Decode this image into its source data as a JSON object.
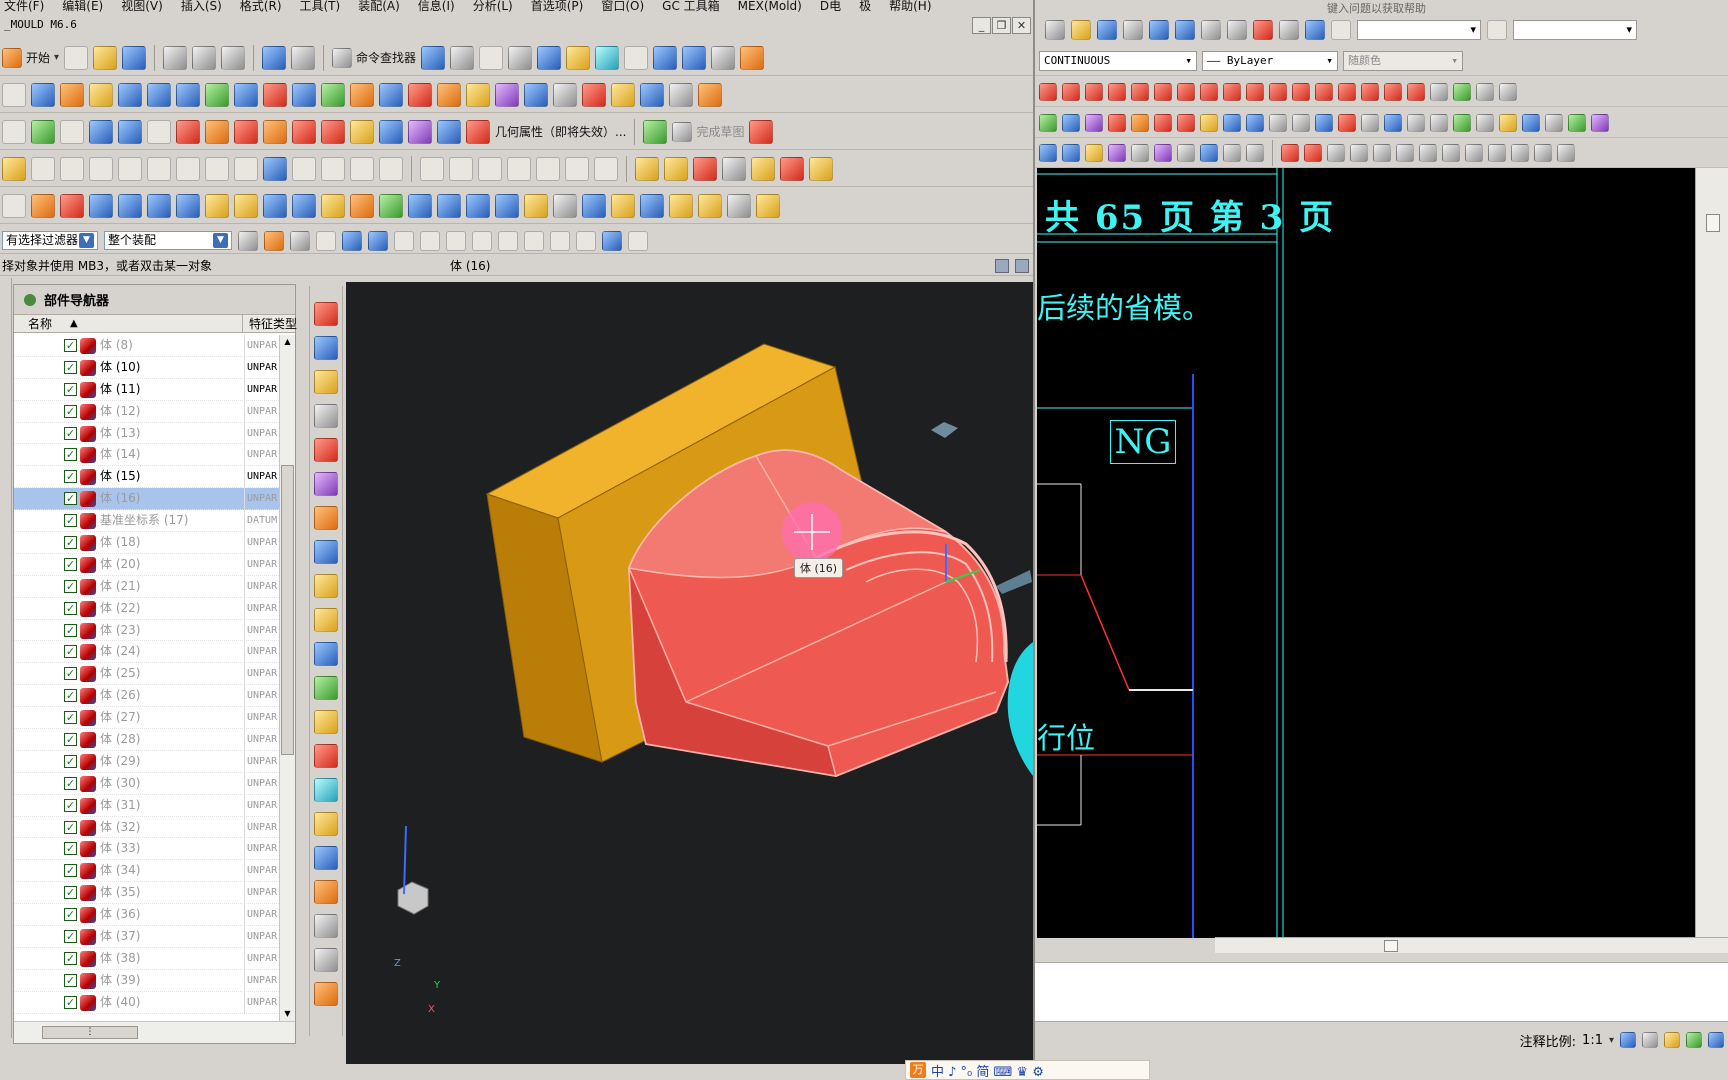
{
  "nx": {
    "menu": [
      "文件(F)",
      "编辑(E)",
      "视图(V)",
      "插入(S)",
      "格式(R)",
      "工具(T)",
      "装配(A)",
      "信息(I)",
      "分析(L)",
      "首选项(P)",
      "窗口(O)",
      "GC 工具箱",
      "MEX(Mold)",
      "D电",
      "极",
      "帮助(H)"
    ],
    "app_title": "_MOULD M6.6",
    "win_buttons": [
      "_",
      "❐",
      "✕"
    ],
    "toolbar": {
      "start_label": "开始",
      "command_finder_label": "命令查找器",
      "geometry_props_label": "几何属性（即将失效）...",
      "finish_sketch_label": "完成草图"
    },
    "filter_bar": {
      "type_filter": "有选择过滤器",
      "scope_filter": "整个装配"
    },
    "status": {
      "prompt": "择对象并使用 MB3，或者双击某一对象",
      "selection": "体 (16)"
    },
    "navigator": {
      "title": "部件导航器",
      "col_name": "名称",
      "col_sort": "▲",
      "col_type": "特征类型",
      "rows": [
        {
          "label": "体 (8)",
          "type": "UNPAR",
          "visible": false,
          "selected": false
        },
        {
          "label": "体 (10)",
          "type": "UNPAR",
          "visible": true,
          "selected": false
        },
        {
          "label": "体 (11)",
          "type": "UNPAR",
          "visible": true,
          "selected": false
        },
        {
          "label": "体 (12)",
          "type": "UNPAR",
          "visible": false,
          "selected": false
        },
        {
          "label": "体 (13)",
          "type": "UNPAR",
          "visible": false,
          "selected": false
        },
        {
          "label": "体 (14)",
          "type": "UNPAR",
          "visible": false,
          "selected": false
        },
        {
          "label": "体 (15)",
          "type": "UNPAR",
          "visible": true,
          "selected": false
        },
        {
          "label": "体 (16)",
          "type": "UNPAR",
          "visible": false,
          "selected": true
        },
        {
          "label": "基准坐标系 (17)",
          "type": "DATUM",
          "visible": false,
          "selected": false
        },
        {
          "label": "体 (18)",
          "type": "UNPAR",
          "visible": false,
          "selected": false
        },
        {
          "label": "体 (20)",
          "type": "UNPAR",
          "visible": false,
          "selected": false
        },
        {
          "label": "体 (21)",
          "type": "UNPAR",
          "visible": false,
          "selected": false
        },
        {
          "label": "体 (22)",
          "type": "UNPAR",
          "visible": false,
          "selected": false
        },
        {
          "label": "体 (23)",
          "type": "UNPAR",
          "visible": false,
          "selected": false
        },
        {
          "label": "体 (24)",
          "type": "UNPAR",
          "visible": false,
          "selected": false
        },
        {
          "label": "体 (25)",
          "type": "UNPAR",
          "visible": false,
          "selected": false
        },
        {
          "label": "体 (26)",
          "type": "UNPAR",
          "visible": false,
          "selected": false
        },
        {
          "label": "体 (27)",
          "type": "UNPAR",
          "visible": false,
          "selected": false
        },
        {
          "label": "体 (28)",
          "type": "UNPAR",
          "visible": false,
          "selected": false
        },
        {
          "label": "体 (29)",
          "type": "UNPAR",
          "visible": false,
          "selected": false
        },
        {
          "label": "体 (30)",
          "type": "UNPAR",
          "visible": false,
          "selected": false
        },
        {
          "label": "体 (31)",
          "type": "UNPAR",
          "visible": false,
          "selected": false
        },
        {
          "label": "体 (32)",
          "type": "UNPAR",
          "visible": false,
          "selected": false
        },
        {
          "label": "体 (33)",
          "type": "UNPAR",
          "visible": false,
          "selected": false
        },
        {
          "label": "体 (34)",
          "type": "UNPAR",
          "visible": false,
          "selected": false
        },
        {
          "label": "体 (35)",
          "type": "UNPAR",
          "visible": false,
          "selected": false
        },
        {
          "label": "体 (36)",
          "type": "UNPAR",
          "visible": false,
          "selected": false
        },
        {
          "label": "体 (37)",
          "type": "UNPAR",
          "visible": false,
          "selected": false
        },
        {
          "label": "体 (38)",
          "type": "UNPAR",
          "visible": false,
          "selected": false
        },
        {
          "label": "体 (39)",
          "type": "UNPAR",
          "visible": false,
          "selected": false
        },
        {
          "label": "体 (40)",
          "type": "UNPAR",
          "visible": false,
          "selected": false
        }
      ]
    },
    "graphics": {
      "tooltip": "体 (16)",
      "bg_color": "#1e1f21",
      "block_color": "#d89a14",
      "body_color": "#f0635a",
      "cyan_color": "#22d6e0",
      "triad_labels": [
        "Z",
        "Y",
        "X"
      ]
    },
    "ime": {
      "logo": "万",
      "text": "中 ♪ °₀ 简 ⌨ ♛ ⚙"
    }
  },
  "cad": {
    "search_hint": "键入问题以获取帮助",
    "linetype": "CONTINUOUS",
    "lineweight": "—— ByLayer",
    "color": "随颜色",
    "drawing": {
      "page_text": "共 65 页 第 3 页",
      "note_text": "后续的省模。",
      "ng_text": "NG",
      "slider_text": "行位",
      "text_color": "#3ff3f3"
    },
    "status": {
      "scale_label": "注释比例:",
      "scale_value": "1:1"
    }
  }
}
